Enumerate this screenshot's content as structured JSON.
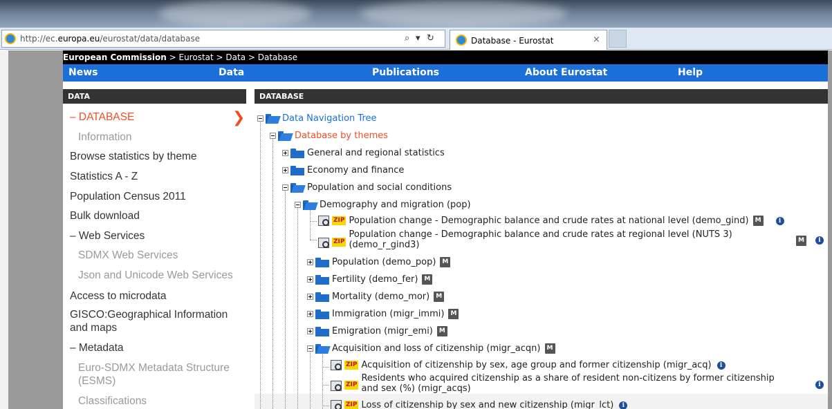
{
  "browser": {
    "url_prefix": "http://ec.",
    "url_domain": "europa.eu",
    "url_path": "/eurostat/data/database",
    "search_glyph": "⌕",
    "dropdown_glyph": "▾",
    "refresh_glyph": "↻",
    "tab_title": "Database - Eurostat",
    "tab_close": "×"
  },
  "breadcrumb": {
    "root": "European Commission",
    "rest": " > Eurostat > Data > Database"
  },
  "navbar": {
    "items": [
      "News",
      "Data",
      "Publications",
      "About Eurostat",
      "Help"
    ]
  },
  "sidebar": {
    "header": "DATA",
    "items": [
      {
        "label": "– DATABASE"
      },
      {
        "label": "Information"
      },
      {
        "label": "Browse statistics by theme"
      },
      {
        "label": "Statistics A - Z"
      },
      {
        "label": "Population Census 2011"
      },
      {
        "label": "Bulk download"
      },
      {
        "label": "– Web Services"
      },
      {
        "label": "SDMX Web Services"
      },
      {
        "label": "Json and Unicode Web Services"
      },
      {
        "label": "Access to microdata"
      },
      {
        "label": "GISCO:Geographical Information"
      },
      {
        "label": "and maps"
      },
      {
        "label": "– Metadata"
      },
      {
        "label": "Euro-SDMX Metadata Structure"
      },
      {
        "label": "(ESMS)"
      },
      {
        "label": "Classifications"
      }
    ],
    "arrow": "❯"
  },
  "main": {
    "header": "DATABASE",
    "tree": {
      "root": "Data Navigation Tree",
      "themes": "Database by themes",
      "general": "General and regional statistics",
      "economy": "Economy and finance",
      "population_social": "Population and social conditions",
      "demography": "Demography and migration (pop)",
      "demo_gind": "Population change - Demographic balance and crude rates at national level (demo_gind)",
      "demo_r_gind3_a": "Population change - Demographic balance and crude rates at regional level (NUTS 3)",
      "demo_r_gind3_b": "(demo_r_gind3)",
      "demo_pop": "Population (demo_pop)",
      "demo_fer": "Fertility (demo_fer)",
      "demo_mor": "Mortality (demo_mor)",
      "migr_immi": "Immigration (migr_immi)",
      "migr_emi": "Emigration (migr_emi)",
      "migr_acqn": "Acquisition and loss of citizenship (migr_acqn)",
      "migr_acq": "Acquisition of citizenship by sex, age group and former citizenship (migr_acq)",
      "migr_acqs_a": "Residents who acquired citizenship as a share of resident non-citizens by former citizenship",
      "migr_acqs_b": "and sex (%) (migr_acqs)",
      "migr_lct": "Loss of citizenship by sex and new citizenship (migr_lct)"
    },
    "zip_label": "ZIP",
    "metadata_label": "M",
    "info_label": "i"
  }
}
